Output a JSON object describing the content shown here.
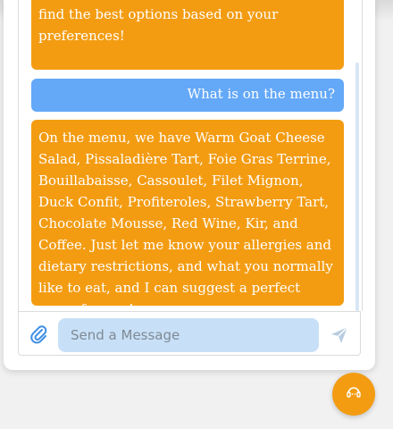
{
  "chat": {
    "messages": [
      {
        "role": "bot",
        "text": "find the best options based on your preferences!"
      },
      {
        "role": "user",
        "text": "What is on the menu?"
      },
      {
        "role": "bot",
        "text": "On the menu, we have Warm Goat Cheese Salad, Pissaladière Tart, Foie Gras Terrine, Bouillabaisse, Cassoulet, Filet Mignon, Duck Confit, Profiteroles, Strawberry Tart, Chocolate Mousse, Red Wine, Kir, and Coffee. Just let me know your allergies and dietary restrictions, and what you normally like to eat, and I can suggest a perfect menu for you!"
      }
    ]
  },
  "composer": {
    "placeholder": "Send a Message",
    "value": ""
  },
  "icons": {
    "attach": "paperclip-icon",
    "send": "send-icon",
    "fab": "chat-bot-icon"
  },
  "colors": {
    "bot_bubble": "#f39c12",
    "user_bubble": "#64a8f8",
    "input_bg": "#c8e0f7"
  }
}
